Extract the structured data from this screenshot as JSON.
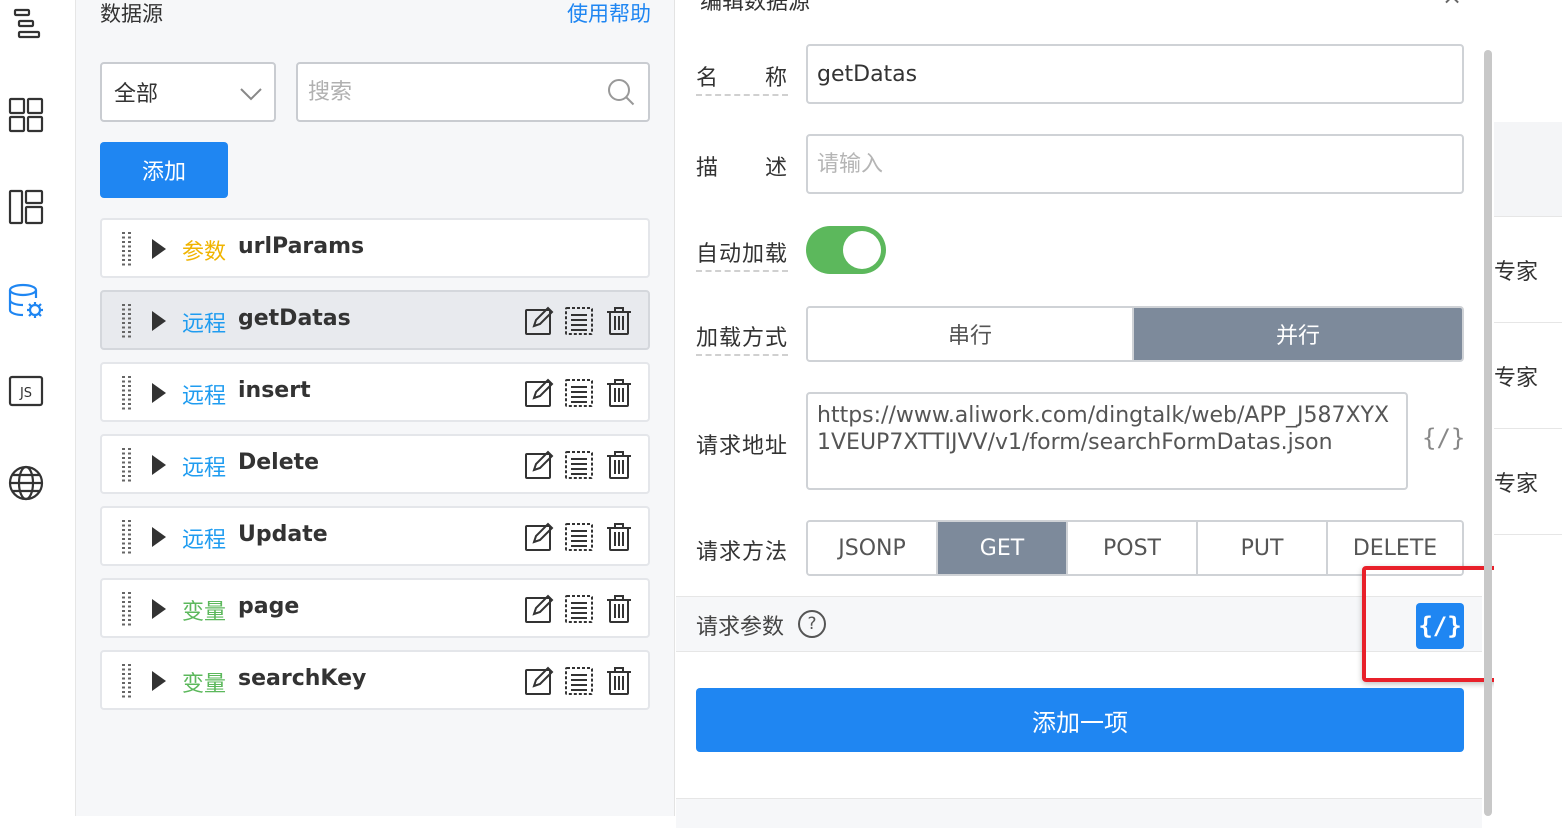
{
  "panel": {
    "title": "数据源",
    "help_label": "使用帮助",
    "filter_value": "全部",
    "search_placeholder": "搜索",
    "add_label": "添加",
    "items": [
      {
        "kind": "参数",
        "kind_color": "#f0b400",
        "name": "urlParams",
        "actions": false
      },
      {
        "kind": "远程",
        "kind_color": "#1f9cf0",
        "name": "getDatas",
        "actions": true
      },
      {
        "kind": "远程",
        "kind_color": "#1f9cf0",
        "name": "insert",
        "actions": true
      },
      {
        "kind": "远程",
        "kind_color": "#1f9cf0",
        "name": "Delete",
        "actions": true
      },
      {
        "kind": "远程",
        "kind_color": "#1f9cf0",
        "name": "Update",
        "actions": true
      },
      {
        "kind": "变量",
        "kind_color": "#5cb85c",
        "name": "page",
        "actions": true
      },
      {
        "kind": "变量",
        "kind_color": "#5cb85c",
        "name": "searchKey",
        "actions": true
      }
    ]
  },
  "editor": {
    "title": "编辑数据源",
    "close": "×",
    "name_label": "名　　称",
    "name_value": "getDatas",
    "desc_label": "描　　述",
    "desc_placeholder": "请输入",
    "autoload_label": "自动加载",
    "autoload_on": true,
    "loadmode_label": "加载方式",
    "loadmode_options": [
      "串行",
      "并行"
    ],
    "loadmode_selected": "并行",
    "url_label": "请求地址",
    "url_value": "https://www.aliwork.com/dingtalk/web/APP_J587XYX1VEUP7XTTIJVV/v1/form/searchFormDatas.json",
    "code_glyph": "{/}",
    "method_label": "请求方法",
    "methods": [
      "JSONP",
      "GET",
      "POST",
      "PUT",
      "DELETE"
    ],
    "method_selected": "GET",
    "params_label": "请求参数",
    "params_help": "?",
    "add_item_label": "添加一项"
  },
  "right": {
    "items": [
      "专家",
      "专家",
      "专家"
    ]
  },
  "colors": {
    "primary": "#1f86f2",
    "toggle_on": "#5cb85c",
    "segment_selected": "#7d8a9b",
    "highlight": "#e8202a"
  }
}
